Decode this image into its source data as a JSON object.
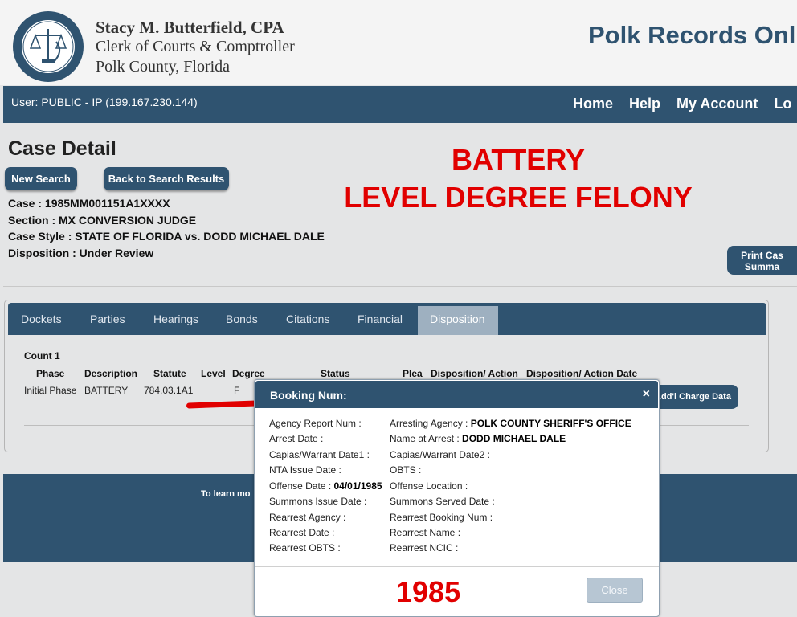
{
  "header": {
    "seal_text": "CLERK & COMPTROLLER · POLK COUNTY FLORIDA",
    "clerk_name": "Stacy M. Butterfield, CPA",
    "clerk_title": "Clerk of Courts & Comptroller",
    "county": "Polk County, Florida",
    "brand": "Polk Records Onl"
  },
  "userbar": {
    "user_info": "User: PUBLIC - IP (199.167.230.144)",
    "nav": [
      "Home",
      "Help",
      "My Account",
      "Lo"
    ]
  },
  "page": {
    "title": "Case Detail",
    "new_search": "New Search",
    "back_to_results": "Back to Search Results",
    "overlay_line1": "BATTERY",
    "overlay_line2": "LEVEL DEGREE FELONY",
    "case": "Case : 1985MM001151A1XXXX",
    "section": "Section : MX CONVERSION JUDGE",
    "case_style": "Case Style : STATE OF FLORIDA vs. DODD MICHAEL DALE",
    "disposition": "Disposition : Under Review",
    "print_line1": "Print Cas",
    "print_line2": "Summa"
  },
  "tabs": [
    "Dockets",
    "Parties",
    "Hearings",
    "Bonds",
    "Citations",
    "Financial",
    "Disposition"
  ],
  "active_tab": "Disposition",
  "charges": {
    "count_label": "Count 1",
    "headers": [
      "Phase",
      "Description",
      "Statute",
      "Level",
      "Degree",
      "Status",
      "Plea",
      "Disposition/ Action",
      "Disposition/ Action Date"
    ],
    "row": {
      "phase": "Initial Phase",
      "description": "BATTERY",
      "statute": "784.03.1A1",
      "degree": "F"
    },
    "addl_button": "Add'l Charge Data"
  },
  "footer": {
    "text": "To learn mo"
  },
  "modal": {
    "title": "Booking Num:",
    "close_icon": "×",
    "left": [
      {
        "label": "Agency Report Num :",
        "value": ""
      },
      {
        "label": "Arrest Date :",
        "value": ""
      },
      {
        "label": "Capias/Warrant Date1 :",
        "value": ""
      },
      {
        "label": "NTA Issue Date :",
        "value": ""
      },
      {
        "label": "Offense Date :",
        "value": "04/01/1985"
      },
      {
        "label": "Summons Issue Date :",
        "value": ""
      },
      {
        "label": "Rearrest Agency :",
        "value": ""
      },
      {
        "label": "Rearrest Date :",
        "value": ""
      },
      {
        "label": "Rearrest OBTS :",
        "value": ""
      }
    ],
    "right": [
      {
        "label": "Arresting Agency :",
        "value": "POLK COUNTY SHERIFF'S OFFICE"
      },
      {
        "label": "Name at Arrest :",
        "value": "DODD MICHAEL DALE"
      },
      {
        "label": "Capias/Warrant Date2 :",
        "value": ""
      },
      {
        "label": "OBTS :",
        "value": ""
      },
      {
        "label": "Offense Location :",
        "value": ""
      },
      {
        "label": "Summons Served Date :",
        "value": ""
      },
      {
        "label": "Rearrest Booking Num :",
        "value": ""
      },
      {
        "label": "Rearrest Name :",
        "value": ""
      },
      {
        "label": "Rearrest NCIC :",
        "value": ""
      }
    ],
    "year": "1985",
    "close_button": "Close"
  },
  "colors": {
    "navy": "#2f5370",
    "annotation_red": "#e10000",
    "active_tab": "#9eb0c0"
  }
}
